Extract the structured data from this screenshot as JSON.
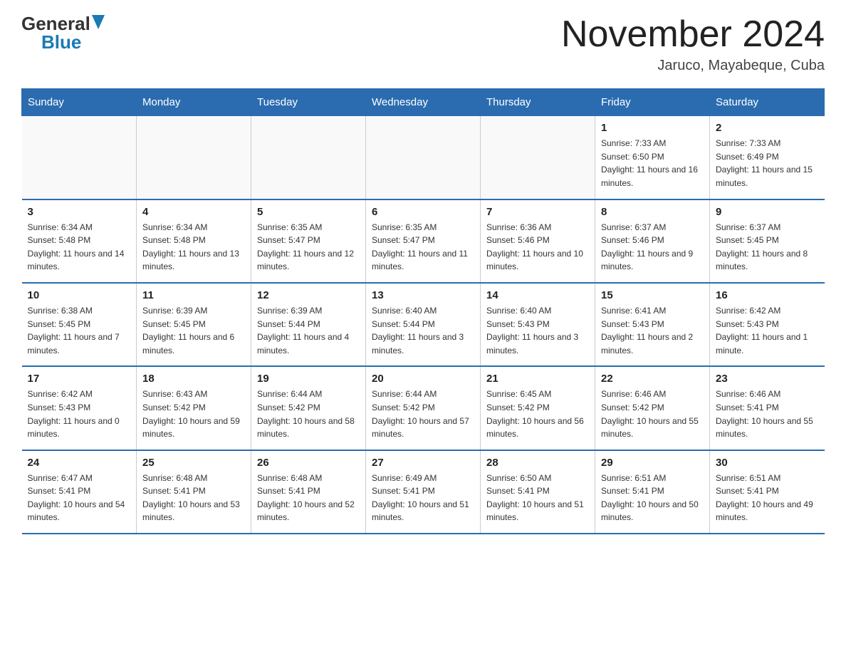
{
  "header": {
    "logo_general": "General",
    "logo_blue": "Blue",
    "month_title": "November 2024",
    "location": "Jaruco, Mayabeque, Cuba"
  },
  "days_of_week": [
    "Sunday",
    "Monday",
    "Tuesday",
    "Wednesday",
    "Thursday",
    "Friday",
    "Saturday"
  ],
  "weeks": [
    [
      {
        "day": "",
        "info": ""
      },
      {
        "day": "",
        "info": ""
      },
      {
        "day": "",
        "info": ""
      },
      {
        "day": "",
        "info": ""
      },
      {
        "day": "",
        "info": ""
      },
      {
        "day": "1",
        "info": "Sunrise: 7:33 AM\nSunset: 6:50 PM\nDaylight: 11 hours and 16 minutes."
      },
      {
        "day": "2",
        "info": "Sunrise: 7:33 AM\nSunset: 6:49 PM\nDaylight: 11 hours and 15 minutes."
      }
    ],
    [
      {
        "day": "3",
        "info": "Sunrise: 6:34 AM\nSunset: 5:48 PM\nDaylight: 11 hours and 14 minutes."
      },
      {
        "day": "4",
        "info": "Sunrise: 6:34 AM\nSunset: 5:48 PM\nDaylight: 11 hours and 13 minutes."
      },
      {
        "day": "5",
        "info": "Sunrise: 6:35 AM\nSunset: 5:47 PM\nDaylight: 11 hours and 12 minutes."
      },
      {
        "day": "6",
        "info": "Sunrise: 6:35 AM\nSunset: 5:47 PM\nDaylight: 11 hours and 11 minutes."
      },
      {
        "day": "7",
        "info": "Sunrise: 6:36 AM\nSunset: 5:46 PM\nDaylight: 11 hours and 10 minutes."
      },
      {
        "day": "8",
        "info": "Sunrise: 6:37 AM\nSunset: 5:46 PM\nDaylight: 11 hours and 9 minutes."
      },
      {
        "day": "9",
        "info": "Sunrise: 6:37 AM\nSunset: 5:45 PM\nDaylight: 11 hours and 8 minutes."
      }
    ],
    [
      {
        "day": "10",
        "info": "Sunrise: 6:38 AM\nSunset: 5:45 PM\nDaylight: 11 hours and 7 minutes."
      },
      {
        "day": "11",
        "info": "Sunrise: 6:39 AM\nSunset: 5:45 PM\nDaylight: 11 hours and 6 minutes."
      },
      {
        "day": "12",
        "info": "Sunrise: 6:39 AM\nSunset: 5:44 PM\nDaylight: 11 hours and 4 minutes."
      },
      {
        "day": "13",
        "info": "Sunrise: 6:40 AM\nSunset: 5:44 PM\nDaylight: 11 hours and 3 minutes."
      },
      {
        "day": "14",
        "info": "Sunrise: 6:40 AM\nSunset: 5:43 PM\nDaylight: 11 hours and 3 minutes."
      },
      {
        "day": "15",
        "info": "Sunrise: 6:41 AM\nSunset: 5:43 PM\nDaylight: 11 hours and 2 minutes."
      },
      {
        "day": "16",
        "info": "Sunrise: 6:42 AM\nSunset: 5:43 PM\nDaylight: 11 hours and 1 minute."
      }
    ],
    [
      {
        "day": "17",
        "info": "Sunrise: 6:42 AM\nSunset: 5:43 PM\nDaylight: 11 hours and 0 minutes."
      },
      {
        "day": "18",
        "info": "Sunrise: 6:43 AM\nSunset: 5:42 PM\nDaylight: 10 hours and 59 minutes."
      },
      {
        "day": "19",
        "info": "Sunrise: 6:44 AM\nSunset: 5:42 PM\nDaylight: 10 hours and 58 minutes."
      },
      {
        "day": "20",
        "info": "Sunrise: 6:44 AM\nSunset: 5:42 PM\nDaylight: 10 hours and 57 minutes."
      },
      {
        "day": "21",
        "info": "Sunrise: 6:45 AM\nSunset: 5:42 PM\nDaylight: 10 hours and 56 minutes."
      },
      {
        "day": "22",
        "info": "Sunrise: 6:46 AM\nSunset: 5:42 PM\nDaylight: 10 hours and 55 minutes."
      },
      {
        "day": "23",
        "info": "Sunrise: 6:46 AM\nSunset: 5:41 PM\nDaylight: 10 hours and 55 minutes."
      }
    ],
    [
      {
        "day": "24",
        "info": "Sunrise: 6:47 AM\nSunset: 5:41 PM\nDaylight: 10 hours and 54 minutes."
      },
      {
        "day": "25",
        "info": "Sunrise: 6:48 AM\nSunset: 5:41 PM\nDaylight: 10 hours and 53 minutes."
      },
      {
        "day": "26",
        "info": "Sunrise: 6:48 AM\nSunset: 5:41 PM\nDaylight: 10 hours and 52 minutes."
      },
      {
        "day": "27",
        "info": "Sunrise: 6:49 AM\nSunset: 5:41 PM\nDaylight: 10 hours and 51 minutes."
      },
      {
        "day": "28",
        "info": "Sunrise: 6:50 AM\nSunset: 5:41 PM\nDaylight: 10 hours and 51 minutes."
      },
      {
        "day": "29",
        "info": "Sunrise: 6:51 AM\nSunset: 5:41 PM\nDaylight: 10 hours and 50 minutes."
      },
      {
        "day": "30",
        "info": "Sunrise: 6:51 AM\nSunset: 5:41 PM\nDaylight: 10 hours and 49 minutes."
      }
    ]
  ]
}
